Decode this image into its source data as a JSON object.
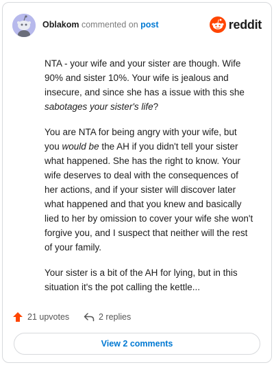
{
  "header": {
    "username": "Oblakom",
    "action": "commented on",
    "post_link": "post",
    "logo_text": "reddit"
  },
  "comment": {
    "paragraphs": [
      [
        {
          "text": "NTA - your wife and your sister are though. Wife 90% and sister 10%. Your wife is jealous and insecure, and since she has a issue with this she ",
          "em": false
        },
        {
          "text": "sabotages your sister's life",
          "em": true
        },
        {
          "text": "?",
          "em": false
        }
      ],
      [
        {
          "text": "You are NTA for being angry with your wife, but you ",
          "em": false
        },
        {
          "text": "would be",
          "em": true
        },
        {
          "text": " the AH if you didn't tell your sister what happened. She has the right to know. Your wife deserves to deal with the consequences of her actions, and if your sister will discover later what happened and that you knew and basically lied to her by omission to cover your wife she won't forgive you, and I suspect that neither will the rest of your family.",
          "em": false
        }
      ],
      [
        {
          "text": "Your sister is a bit of the AH for lying, but in this situation it's the pot calling the kettle...",
          "em": false
        }
      ]
    ]
  },
  "footer": {
    "upvotes_label": "21 upvotes",
    "replies_label": "2 replies",
    "view_comments_label": "View 2 comments"
  },
  "colors": {
    "upvote": "#ff4500",
    "link": "#0079d3",
    "avatar_bg": "#b7b9ec",
    "reddit_orange": "#ff4500"
  },
  "icons": {
    "avatar": "snoo-avatar",
    "logo": "reddit-logo-icon",
    "upvote": "upvote-arrow-icon",
    "reply": "reply-arrow-icon"
  }
}
